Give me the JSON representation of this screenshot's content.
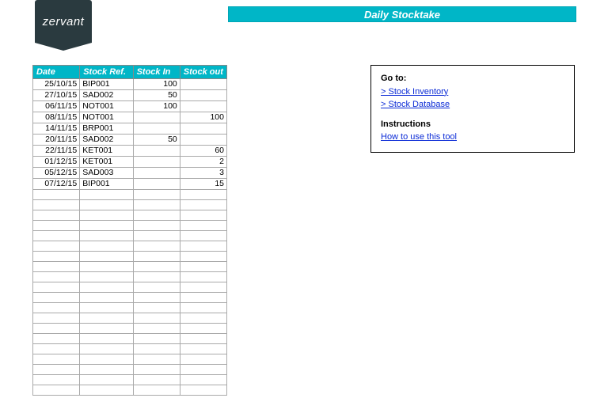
{
  "logo_text": "zervant",
  "title": "Daily Stocktake",
  "table": {
    "headers": [
      "Date",
      "Stock Ref.",
      "Stock In",
      "Stock out"
    ],
    "rows": [
      {
        "date": "25/10/15",
        "ref": "BIP001",
        "in": "100",
        "out": ""
      },
      {
        "date": "27/10/15",
        "ref": "SAD002",
        "in": "50",
        "out": ""
      },
      {
        "date": "06/11/15",
        "ref": "NOT001",
        "in": "100",
        "out": ""
      },
      {
        "date": "08/11/15",
        "ref": "NOT001",
        "in": "",
        "out": "100"
      },
      {
        "date": "14/11/15",
        "ref": "BRP001",
        "in": "",
        "out": ""
      },
      {
        "date": "20/11/15",
        "ref": "SAD002",
        "in": "50",
        "out": ""
      },
      {
        "date": "22/11/15",
        "ref": "KET001",
        "in": "",
        "out": "60"
      },
      {
        "date": "01/12/15",
        "ref": "KET001",
        "in": "",
        "out": "2"
      },
      {
        "date": "05/12/15",
        "ref": "SAD003",
        "in": "",
        "out": "3"
      },
      {
        "date": "07/12/15",
        "ref": "BIP001",
        "in": "",
        "out": "15"
      }
    ],
    "empty_row_count": 20
  },
  "info": {
    "goto_label": "Go to:",
    "link_inventory": "> Stock Inventory",
    "link_database": "> Stock Database",
    "instructions_label": "Instructions",
    "link_howto": "How to use this tool"
  }
}
